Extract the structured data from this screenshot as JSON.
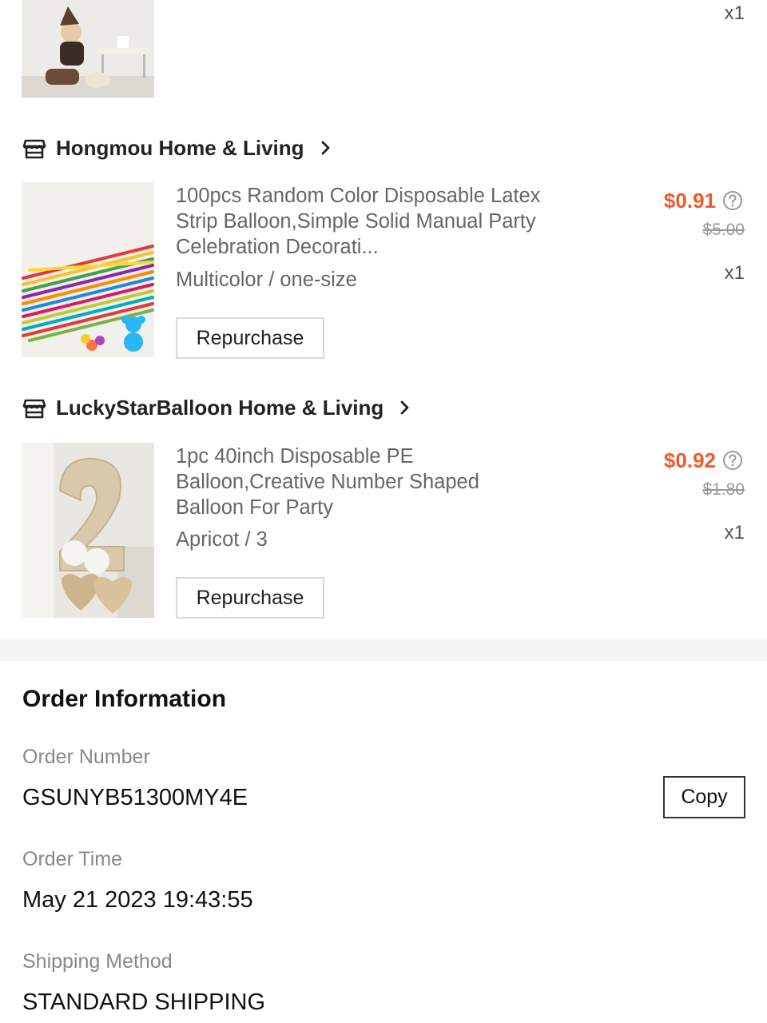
{
  "items": [
    {
      "quantity": "x1",
      "image": "kid-party-photo"
    }
  ],
  "stores": [
    {
      "name": "Hongmou Home & Living",
      "product": {
        "title": "100pcs Random Color Disposable Latex Strip Balloon,Simple Solid Manual Party Celebration Decorati...",
        "variant": "Multicolor / one-size",
        "price": "$0.91",
        "original_price": "$5.00",
        "quantity": "x1",
        "repurchase_label": "Repurchase",
        "image": "colorful-strip-balloons"
      }
    },
    {
      "name": "LuckyStarBalloon Home & Living",
      "product": {
        "title": "1pc 40inch Disposable PE Balloon,Creative Number Shaped Balloon For Party",
        "variant": "Apricot / 3",
        "price": "$0.92",
        "original_price": "$1.80",
        "quantity": "x1",
        "repurchase_label": "Repurchase",
        "image": "number-balloon"
      }
    }
  ],
  "order_info": {
    "title": "Order Information",
    "order_number_label": "Order Number",
    "order_number": "GSUNYB51300MY4E",
    "copy_label": "Copy",
    "order_time_label": "Order Time",
    "order_time": "May 21 2023 19:43:55",
    "shipping_method_label": "Shipping Method",
    "shipping_method": "STANDARD SHIPPING"
  },
  "icons": {
    "store": "store-icon",
    "chevron": "chevron-right-icon",
    "help": "help-circle-icon"
  },
  "colors": {
    "price": "#f05a2a",
    "muted": "#888888",
    "divider": "#f5f5f5"
  }
}
